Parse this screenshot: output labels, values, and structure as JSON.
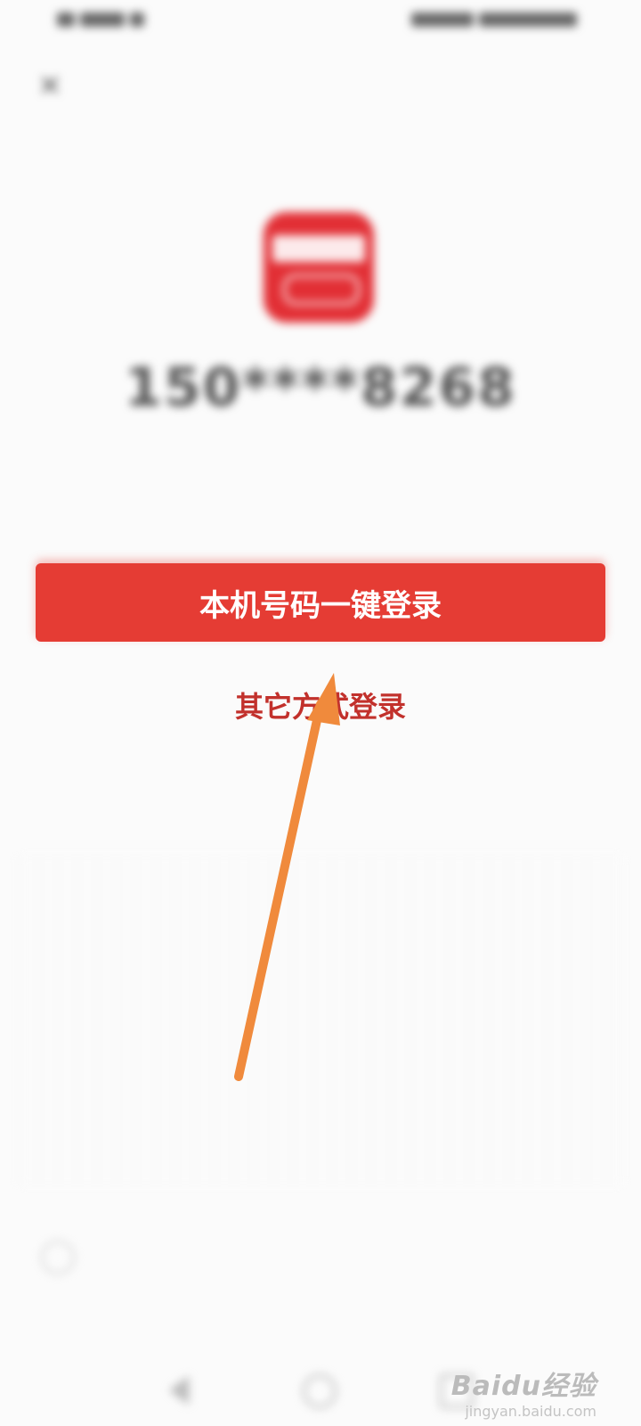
{
  "status_bar": {
    "left": "",
    "right": ""
  },
  "header": {
    "close_icon": "close-icon"
  },
  "account": {
    "phone_number": "150****8268",
    "carrier_note": ""
  },
  "actions": {
    "one_click_login": "本机号码一键登录",
    "other_login": "其它方式登录"
  },
  "agreement": {
    "text": "",
    "link_1": "",
    "link_2": "",
    "link_3": ""
  },
  "nav_bar": {
    "icons": [
      "back-icon",
      "home-icon",
      "recent-apps-icon"
    ]
  },
  "watermark": {
    "brand": "Baidu经验",
    "url": "jingyan.baidu.com"
  },
  "colors": {
    "brand_red": "#e53c34",
    "link_red": "#c2312c",
    "annotation_arrow": "#f08a3c",
    "link_blue": "#3c8ee6"
  }
}
